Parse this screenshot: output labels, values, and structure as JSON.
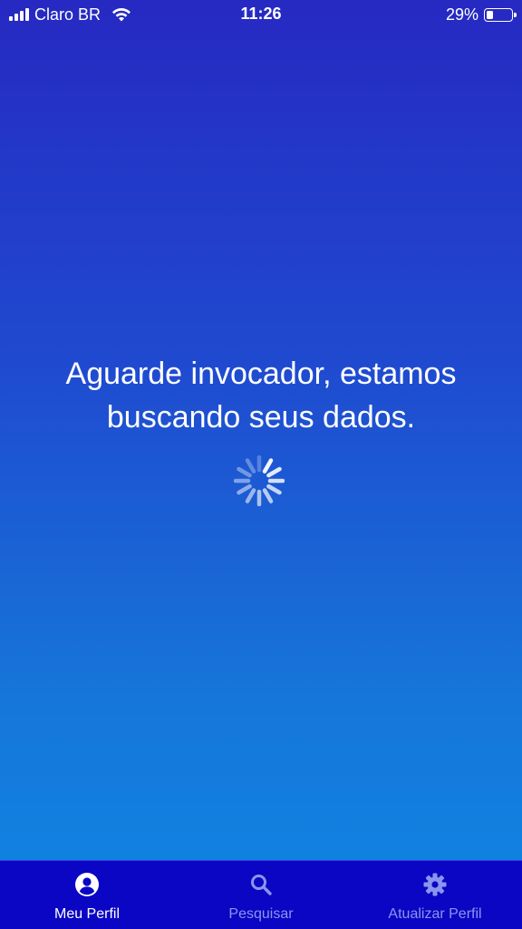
{
  "status_bar": {
    "carrier": "Claro BR",
    "time": "11:26",
    "battery_percent": "29%",
    "battery_level": 0.29,
    "signal_bars": 4,
    "icons": [
      "signal-icon",
      "wifi-icon",
      "battery-icon"
    ]
  },
  "main": {
    "message": "Aguarde invocador, estamos\nbuscando seus dados.",
    "spinner_icon": "loading-spinner-icon"
  },
  "tab_bar": {
    "tabs": [
      {
        "label": "Meu Perfil",
        "icon": "user-circle-icon",
        "active": true
      },
      {
        "label": "Pesquisar",
        "icon": "search-icon",
        "active": false
      },
      {
        "label": "Atualizar Perfil",
        "icon": "gear-icon",
        "active": false
      }
    ]
  },
  "colors": {
    "background_top": "#2629c2",
    "background_bottom": "#0e86e3",
    "tab_bar": "#0a06c4",
    "active": "#ffffff",
    "inactive": "#8a96ee"
  }
}
